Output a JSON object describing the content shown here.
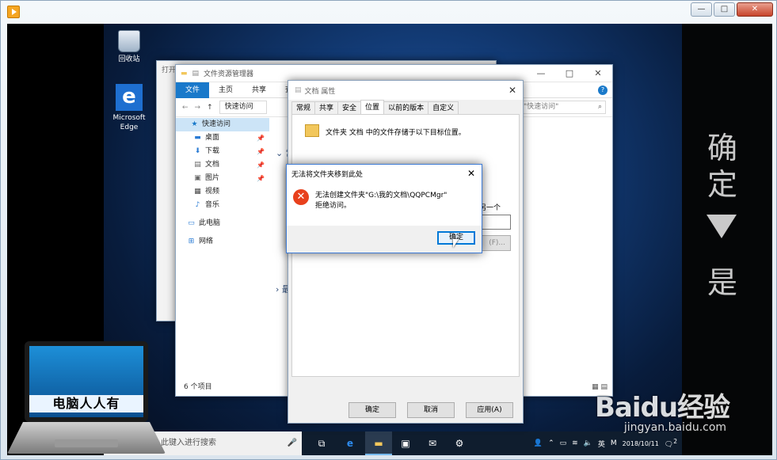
{
  "desktop": {
    "icons": [
      {
        "label": "回收站",
        "icon": "recycle-bin-icon"
      },
      {
        "label": "Microsoft Edge",
        "icon": "edge-icon"
      }
    ]
  },
  "right_panel": {
    "chars": [
      "确",
      "定",
      "是"
    ]
  },
  "background_window": {
    "title": "打开"
  },
  "explorer": {
    "title": "文件资源管理器",
    "ribbon_tabs": [
      "文件",
      "主页",
      "共享",
      "查看"
    ],
    "address": "快速访问",
    "search_placeholder": "索\"快速访问\"",
    "nav_items": [
      {
        "label": "快速访问",
        "icon": "star-icon",
        "pinned": false
      },
      {
        "label": "桌面",
        "icon": "desktop-icon",
        "pinned": true
      },
      {
        "label": "下载",
        "icon": "download-icon",
        "pinned": true
      },
      {
        "label": "文档",
        "icon": "document-icon",
        "pinned": true
      },
      {
        "label": "图片",
        "icon": "picture-icon",
        "pinned": true
      },
      {
        "label": "视频",
        "icon": "video-icon",
        "pinned": false
      },
      {
        "label": "音乐",
        "icon": "music-icon",
        "pinned": false
      },
      {
        "label": "此电脑",
        "icon": "computer-icon",
        "pinned": false
      },
      {
        "label": "网络",
        "icon": "network-icon",
        "pinned": false
      }
    ],
    "section_frequent": "常",
    "section_recent": "最",
    "status": "6 个项目"
  },
  "properties": {
    "title": "文档 属性",
    "tabs": [
      "常规",
      "共享",
      "安全",
      "位置",
      "以前的版本",
      "自定义"
    ],
    "active_tab": "位置",
    "description": "文件夹 文档 中的文件存储于以下目标位置。",
    "fragment": "另一个",
    "dim_button": "(F)...",
    "buttons": {
      "ok": "确定",
      "cancel": "取消",
      "apply": "应用(A)"
    }
  },
  "error_dialog": {
    "title": "无法将文件夹移到此处",
    "message_line1": "无法创建文件夹\"G:\\我的文档\\QQPCMgr\"",
    "message_line2": "拒绝访问。",
    "ok_button": "确定"
  },
  "taskbar": {
    "search_placeholder": "此键入进行搜索",
    "ime": "英",
    "date": "2018/10/11",
    "notification_count": "2"
  },
  "logo": {
    "text": "电脑人人有"
  },
  "watermark": {
    "logo": "Baidu经验",
    "url": "jingyan.baidu.com"
  }
}
